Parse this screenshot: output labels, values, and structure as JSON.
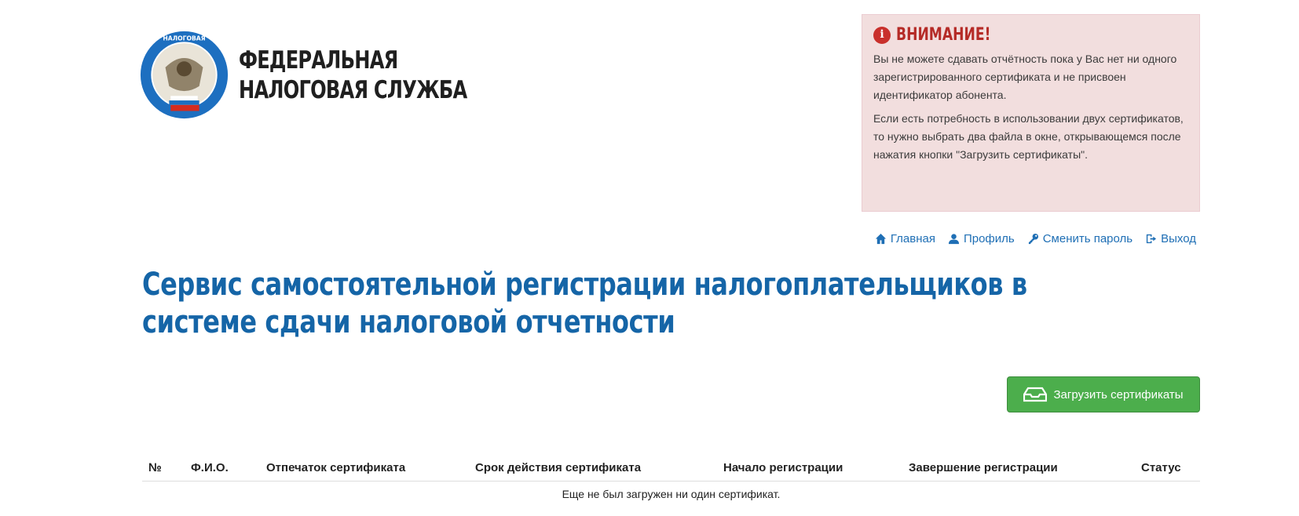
{
  "header": {
    "org_name_line1": "ФЕДЕРАЛЬНАЯ",
    "org_name_line2": "НАЛОГОВАЯ СЛУЖБА",
    "emblem_icon": "fns-emblem-icon"
  },
  "alert": {
    "title": "ВНИМАНИЕ!",
    "icon": "info-icon",
    "paragraph1": "Вы не можете сдавать отчётность пока у Вас нет ни одного зарегистрированного сертификата и не присвоен идентификатор абонента.",
    "paragraph2": "Если есть потребность в использовании двух сертификатов, то нужно выбрать два файла в окне, открывающемся после нажатия кнопки \"Загрузить сертификаты\"."
  },
  "nav": {
    "home": "Главная",
    "profile": "Профиль",
    "change_password": "Сменить пароль",
    "logout": "Выход"
  },
  "page_title": "Сервис самостоятельной регистрации налогоплательщиков в системе сдачи налоговой отчетности",
  "upload_button": {
    "label": "Загрузить сертификаты",
    "icon": "upload-tray-icon"
  },
  "table": {
    "columns": [
      "№",
      "Ф.И.О.",
      "Отпечаток сертификата",
      "Срок действия сертификата",
      "Начало регистрации",
      "Завершение регистрации",
      "Статус"
    ],
    "empty_message": "Еще не был загружен ни один сертификат."
  },
  "colors": {
    "brand_blue": "#1565a7",
    "link_blue": "#1f6fb5",
    "alert_bg": "#f2dede",
    "alert_red": "#b52b27",
    "button_green": "#4cae4c"
  }
}
